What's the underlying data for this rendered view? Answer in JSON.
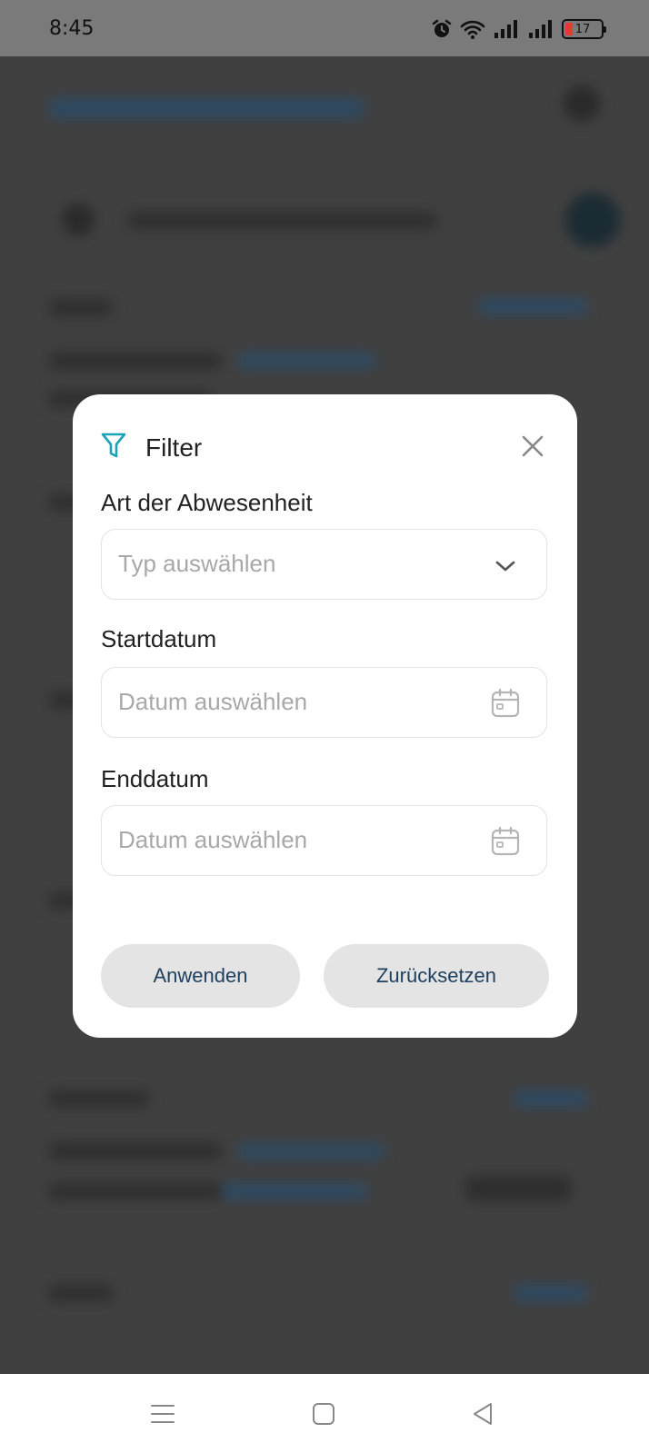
{
  "status_bar": {
    "time": "8:45",
    "battery_level": "17",
    "icons": [
      "alarm-icon",
      "wifi-icon",
      "signal-icon",
      "signal-icon",
      "battery-icon"
    ]
  },
  "dialog": {
    "title": "Filter",
    "accent_color": "#1aa3b6",
    "fields": [
      {
        "label": "Art der Abwesenheit",
        "placeholder": "Typ auswählen",
        "icon": "chevron-down-icon"
      },
      {
        "label": "Startdatum",
        "placeholder": "Datum auswählen",
        "icon": "calendar-icon"
      },
      {
        "label": "Enddatum",
        "placeholder": "Datum auswählen",
        "icon": "calendar-icon"
      }
    ],
    "apply_label": "Anwenden",
    "reset_label": "Zurücksetzen"
  },
  "nav_bar": {
    "icons": [
      "menu-icon",
      "home-icon",
      "back-icon"
    ]
  }
}
